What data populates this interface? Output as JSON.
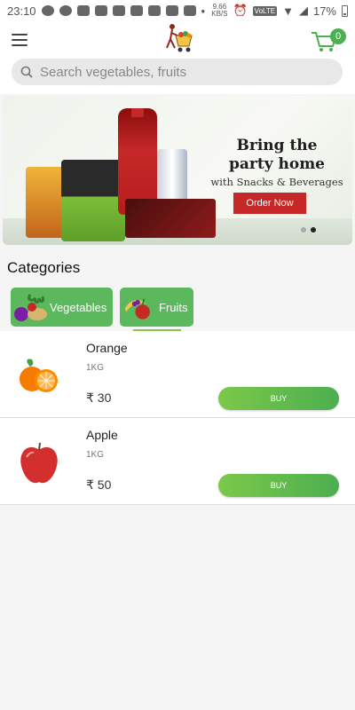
{
  "status_bar": {
    "time": "23:10",
    "net_speed": "9.66",
    "net_unit": "KB/S",
    "network": "VoLTE",
    "battery": "17%"
  },
  "header": {
    "cart_count": "0",
    "search_placeholder": "Search vegetables, fruits"
  },
  "banner": {
    "title_line1": "Bring the",
    "title_line2": "party home",
    "subtitle": "with Snacks & Beverages",
    "cta": "Order Now",
    "slide_index": 2,
    "slide_count": 2
  },
  "categories": {
    "title": "Categories",
    "items": [
      {
        "label": "Vegetables",
        "selected": false
      },
      {
        "label": "Fruits",
        "selected": true
      }
    ]
  },
  "products": [
    {
      "name": "Orange",
      "qty": "1KG",
      "price": "₹ 30",
      "buy": "BUY"
    },
    {
      "name": "Apple",
      "qty": "1KG",
      "price": "₹ 50",
      "buy": "BUY"
    }
  ],
  "colors": {
    "accent_green": "#4caf50",
    "banner_cta": "#c62828"
  }
}
